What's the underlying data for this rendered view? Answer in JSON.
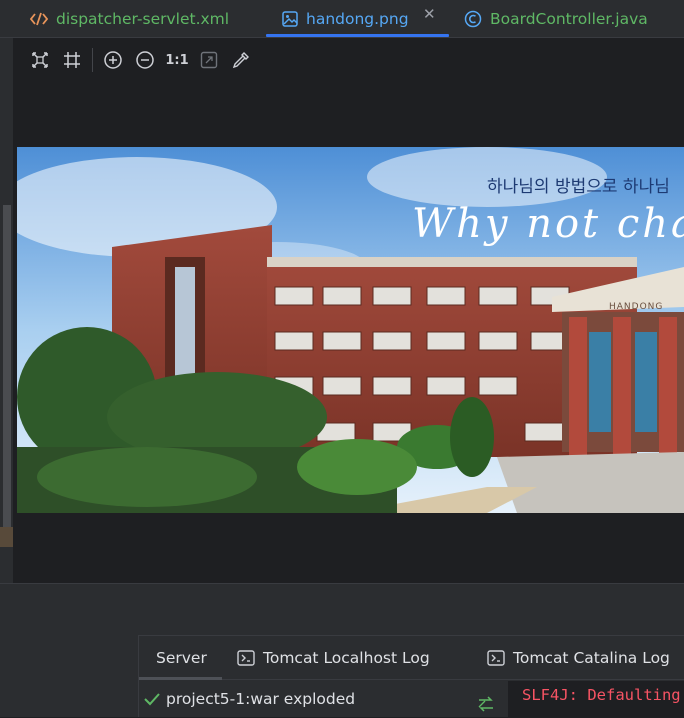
{
  "tabs": [
    {
      "label": "dispatcher-servlet.xml",
      "icon": "xml-file-icon"
    },
    {
      "label": "handong.png",
      "icon": "image-file-icon",
      "active": true
    },
    {
      "label": "BoardController.java",
      "icon": "java-class-icon"
    }
  ],
  "image_viewer": {
    "toolbar": {
      "actual_size_label": "1:1"
    },
    "image": {
      "korean_text": "하나님의 방법으로 하나님",
      "slogan": "Why not cha",
      "building_sign": "HANDONG"
    }
  },
  "services": {
    "tabs": [
      {
        "label": "Server"
      },
      {
        "label": "Tomcat Localhost Log"
      },
      {
        "label": "Tomcat Catalina Log"
      }
    ],
    "deployment": {
      "label": "project5-1:war exploded"
    },
    "console_line": "SLF4J: Defaulting"
  },
  "colors": {
    "accent": "#3574f0",
    "green": "#5fb865",
    "error": "#f75464"
  }
}
